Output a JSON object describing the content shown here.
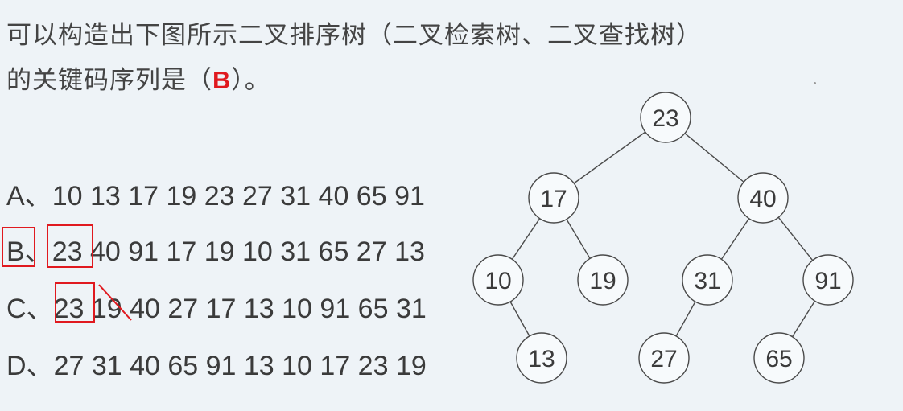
{
  "question": {
    "line1": "可以构造出下图所示二叉排序树（二叉检索树、二叉查找树）",
    "line2_prefix": "的关键码序列是（",
    "answer": "B",
    "line2_suffix": "）。"
  },
  "options": [
    {
      "letter": "A、",
      "sequence": "10 13 17 19 23 27 31 40 65 91"
    },
    {
      "letter": "B、",
      "sequence": "23 40 91 17 19 10 31 65 27 13"
    },
    {
      "letter": "C、",
      "sequence": "23 19 40 27 17 13 10 91 65 31"
    },
    {
      "letter": "D、",
      "sequence": "27 31 40 65 91 13 10 17 23 19"
    }
  ],
  "tree": {
    "nodes": [
      {
        "id": "n23",
        "value": "23"
      },
      {
        "id": "n17",
        "value": "17"
      },
      {
        "id": "n40",
        "value": "40"
      },
      {
        "id": "n10",
        "value": "10"
      },
      {
        "id": "n19",
        "value": "19"
      },
      {
        "id": "n31",
        "value": "31"
      },
      {
        "id": "n91",
        "value": "91"
      },
      {
        "id": "n13",
        "value": "13"
      },
      {
        "id": "n27",
        "value": "27"
      },
      {
        "id": "n65",
        "value": "65"
      }
    ],
    "edges": [
      [
        "n23",
        "n17"
      ],
      [
        "n23",
        "n40"
      ],
      [
        "n17",
        "n10"
      ],
      [
        "n17",
        "n19"
      ],
      [
        "n40",
        "n31"
      ],
      [
        "n40",
        "n91"
      ],
      [
        "n10",
        "n13"
      ],
      [
        "n31",
        "n27"
      ],
      [
        "n91",
        "n65"
      ]
    ]
  },
  "colors": {
    "annotation": "#e0191f",
    "text": "#3b3b3b",
    "background": "#eef3f7"
  }
}
